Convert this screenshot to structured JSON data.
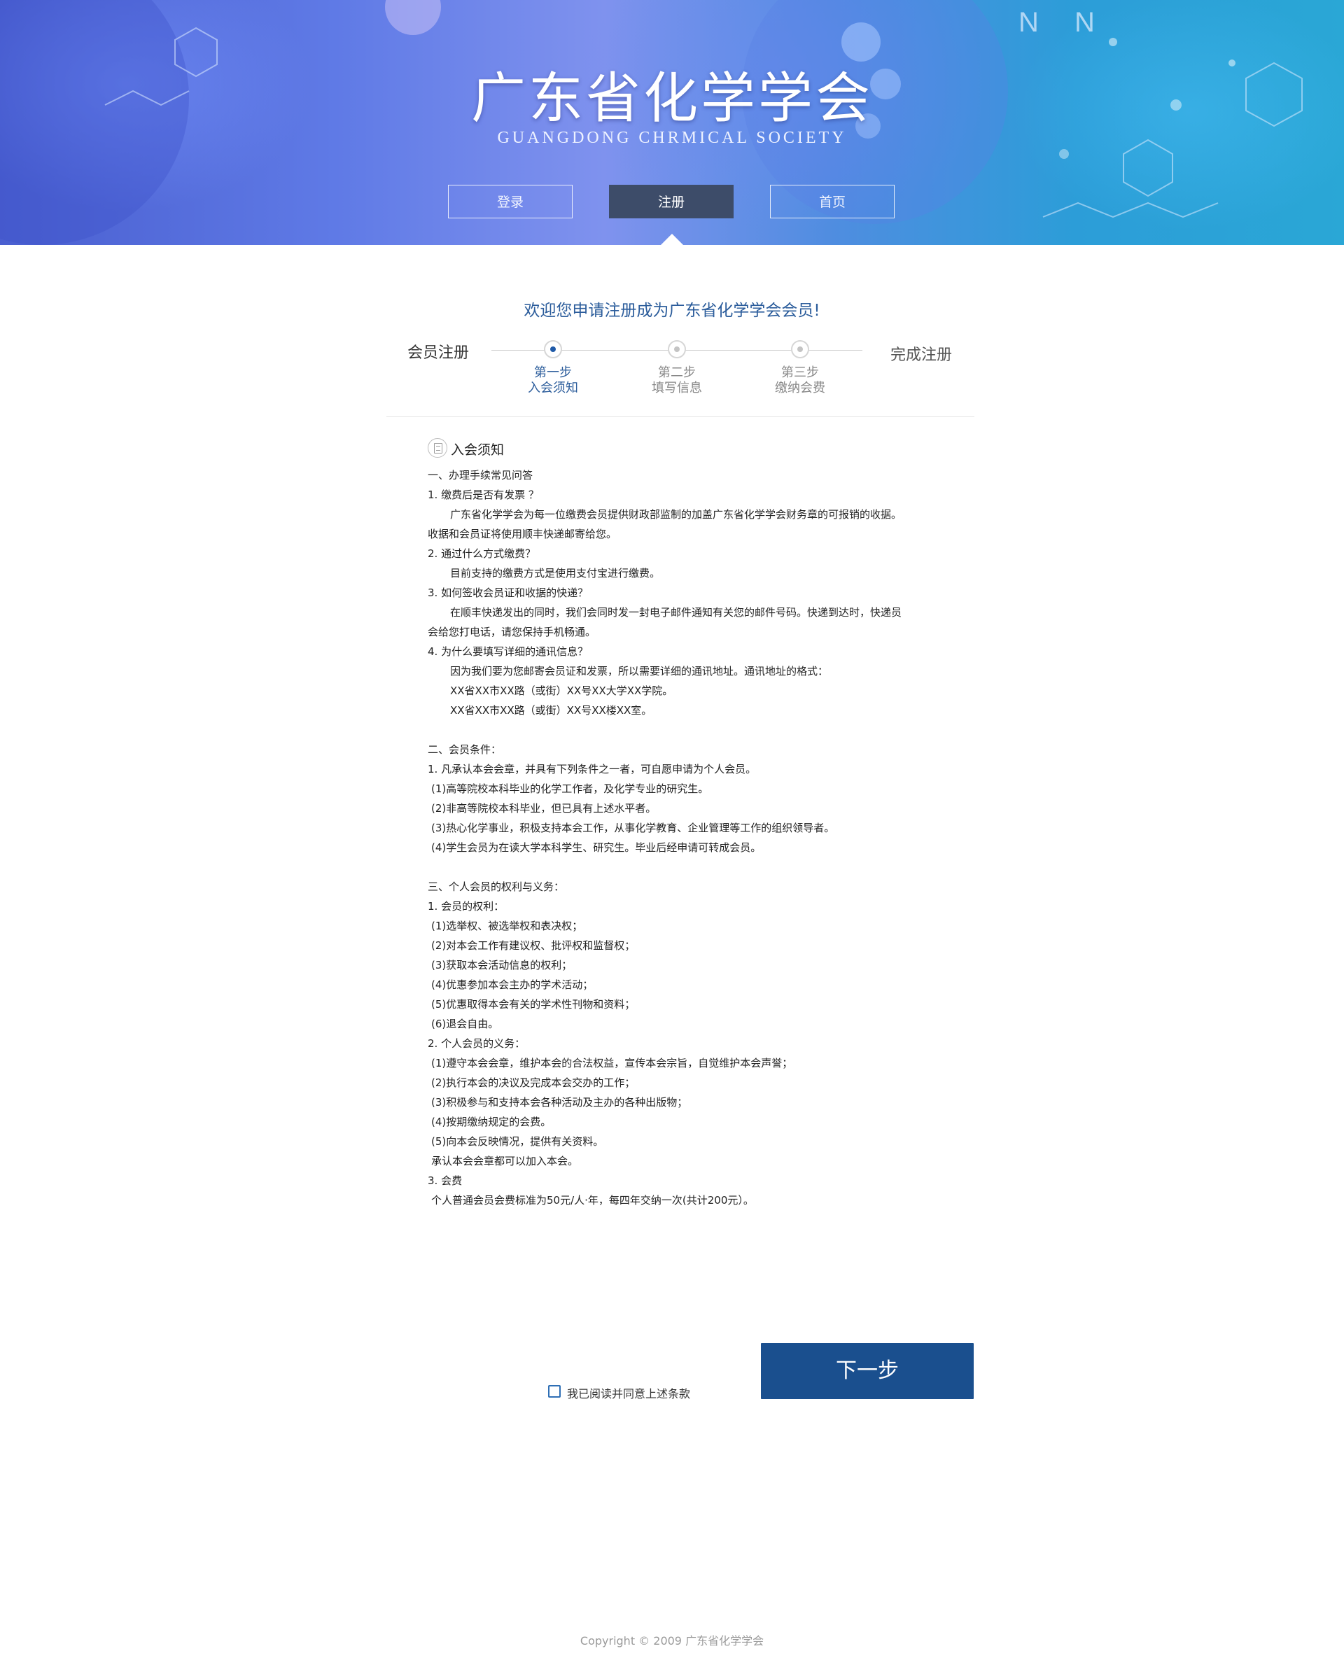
{
  "header": {
    "title": "广东省化学学会",
    "subtitle": "GUANGDONG CHRMICAL SOCIETY",
    "nav": [
      {
        "label": "登录"
      },
      {
        "label": "注册"
      },
      {
        "label": "首页"
      }
    ],
    "active_nav": "注册"
  },
  "registration": {
    "welcome": "欢迎您申请注册成为广东省化学学会会员!",
    "start_label": "会员注册",
    "end_label": "完成注册",
    "steps": [
      {
        "step": "第一步",
        "name": "入会须知",
        "active": true
      },
      {
        "step": "第二步",
        "name": "填写信息",
        "active": false
      },
      {
        "step": "第三步",
        "name": "缴纳会费",
        "active": false
      }
    ]
  },
  "notice": {
    "icon": "document-icon",
    "title": "入会须知",
    "lines": [
      "一、办理手续常见问答",
      "1. 缴费后是否有发票 ？",
      "广东省化学学会为每一位缴费会员提供财政部监制的加盖广东省化学学会财务章的可报销的收据。",
      "收据和会员证将使用顺丰快递邮寄给您。",
      "2. 通过什么方式缴费？",
      "目前支持的缴费方式是使用支付宝进行缴费。",
      "3. 如何签收会员证和收据的快递？",
      "在顺丰快递发出的同时，我们会同时发一封电子邮件通知有关您的邮件号码。快递到达时，快递员",
      "会给您打电话，请您保持手机畅通。",
      "4. 为什么要填写详细的通讯信息？",
      "因为我们要为您邮寄会员证和发票，所以需要详细的通讯地址。通讯地址的格式：",
      "XX省XX市XX路（或街）XX号XX大学XX学院。",
      "XX省XX市XX路（或街）XX号XX楼XX室。",
      "二、会员条件：",
      "1. 凡承认本会会章，并具有下列条件之一者，可自愿申请为个人会员。",
      "(1)高等院校本科毕业的化学工作者，及化学专业的研究生。",
      "(2)非高等院校本科毕业，但已具有上述水平者。",
      "(3)热心化学事业，积极支持本会工作，从事化学教育、企业管理等工作的组织领导者。",
      "(4)学生会员为在读大学本科学生、研究生。毕业后经申请可转成会员。",
      "三、个人会员的权利与义务：",
      "1. 会员的权利：",
      "(1)选举权、被选举权和表决权；",
      "(2)对本会工作有建议权、批评权和监督权；",
      "(3)获取本会活动信息的权利；",
      "(4)优惠参加本会主办的学术活动；",
      "(5)优惠取得本会有关的学术性刊物和资料；",
      "(6)退会自由。",
      "2. 个人会员的义务：",
      "(1)遵守本会会章，维护本会的合法权益，宣传本会宗旨，自觉维护本会声誉；",
      "(2)执行本会的决议及完成本会交办的工作；",
      "(3)积极参与和支持本会各种活动及主办的各种出版物；",
      "(4)按期缴纳规定的会费。",
      "(5)向本会反映情况，提供有关资料。",
      "承认本会会章都可以加入本会。",
      "3. 会费",
      "个人普通会员会费标准为50元/人·年，每四年交纳一次(共计200元）。"
    ]
  },
  "actions": {
    "agree_label": "我已阅读并同意上述条款",
    "agree_checked": false,
    "next_label": "下一步"
  },
  "footer": {
    "copyright": "Copyright © 2009 广东省化学学会"
  },
  "colors": {
    "accent": "#1a4f8e",
    "active_nav_bg": "#3d4c69",
    "link_blue": "#2b5c9b"
  }
}
